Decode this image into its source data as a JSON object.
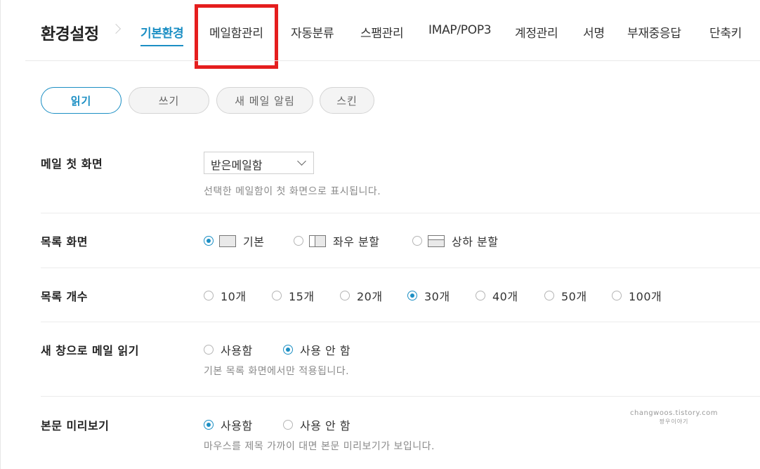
{
  "header": {
    "title": "환경설정",
    "tabs": [
      {
        "label": "기본환경",
        "active": true
      },
      {
        "label": "메일함관리",
        "active": false
      },
      {
        "label": "자동분류",
        "active": false
      },
      {
        "label": "스팸관리",
        "active": false
      },
      {
        "label": "IMAP/POP3",
        "active": false
      },
      {
        "label": "계정관리",
        "active": false
      },
      {
        "label": "서명",
        "active": false
      },
      {
        "label": "부재중응답",
        "active": false
      },
      {
        "label": "단축키",
        "active": false
      }
    ],
    "highlight_color": "#e51e1e",
    "accent_color": "#1c8fc4"
  },
  "subtabs": [
    {
      "label": "읽기",
      "active": true
    },
    {
      "label": "쓰기",
      "active": false
    },
    {
      "label": "새 메일 알림",
      "active": false
    },
    {
      "label": "스킨",
      "active": false
    }
  ],
  "settings": {
    "first_screen": {
      "label": "메일 첫 화면",
      "selected": "받은메일함",
      "hint": "선택한 메일함이 첫 화면으로 표시됩니다."
    },
    "list_view": {
      "label": "목록 화면",
      "options": [
        {
          "label": "기본",
          "icon": "layout-basic-icon",
          "checked": true
        },
        {
          "label": "좌우 분할",
          "icon": "layout-split-lr-icon",
          "checked": false
        },
        {
          "label": "상하 분할",
          "icon": "layout-split-tb-icon",
          "checked": false
        }
      ]
    },
    "list_count": {
      "label": "목록 개수",
      "options": [
        {
          "label": "10개",
          "checked": false
        },
        {
          "label": "15개",
          "checked": false
        },
        {
          "label": "20개",
          "checked": false
        },
        {
          "label": "30개",
          "checked": true
        },
        {
          "label": "40개",
          "checked": false
        },
        {
          "label": "50개",
          "checked": false
        },
        {
          "label": "100개",
          "checked": false
        }
      ]
    },
    "new_window": {
      "label": "새 창으로 메일 읽기",
      "options": [
        {
          "label": "사용함",
          "checked": false
        },
        {
          "label": "사용 안 함",
          "checked": true
        }
      ],
      "hint": "기본 목록 화면에서만 적용됩니다."
    },
    "preview": {
      "label": "본문 미리보기",
      "options": [
        {
          "label": "사용함",
          "checked": true
        },
        {
          "label": "사용 안 함",
          "checked": false
        }
      ],
      "hint": "마우스를 제목 가까이 대면 본문 미리보기가 보입니다."
    }
  },
  "watermark": {
    "line1": "changwoos.tistory.com",
    "line2": "짱우이야기"
  }
}
